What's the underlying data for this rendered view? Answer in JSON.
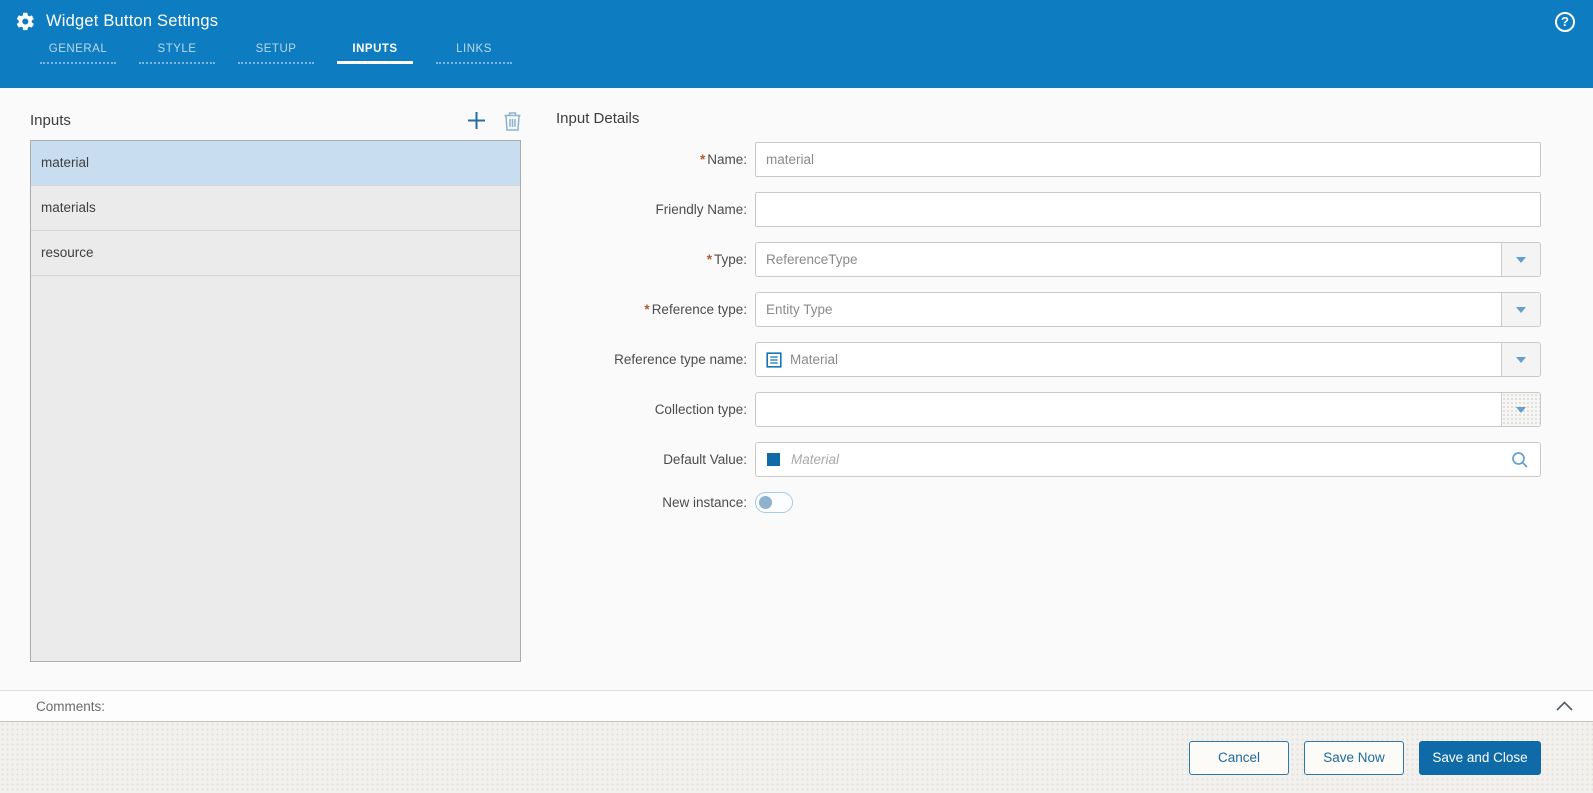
{
  "colors": {
    "header_blue": "#0d7cc1",
    "accent_blue": "#0e6ba8",
    "selected_item_bg": "#c8def0",
    "required_marker_color": "#b35a28"
  },
  "header": {
    "title": "Widget Button Settings",
    "tabs": [
      {
        "label": "GENERAL",
        "active": false
      },
      {
        "label": "STYLE",
        "active": false
      },
      {
        "label": "SETUP",
        "active": false
      },
      {
        "label": "INPUTS",
        "active": true
      },
      {
        "label": "LINKS",
        "active": false
      }
    ]
  },
  "inputs_panel": {
    "title": "Inputs",
    "items": [
      {
        "label": "material",
        "selected": true
      },
      {
        "label": "materials",
        "selected": false
      },
      {
        "label": "resource",
        "selected": false
      }
    ]
  },
  "details": {
    "title": "Input Details",
    "required_marker": "*",
    "fields": {
      "name": {
        "label": "Name:",
        "required": true,
        "value": "material"
      },
      "friendly_name": {
        "label": "Friendly Name:",
        "required": false,
        "value": ""
      },
      "type": {
        "label": "Type:",
        "required": true,
        "value": "ReferenceType"
      },
      "reference_type": {
        "label": "Reference type:",
        "required": true,
        "value": "Entity Type"
      },
      "reference_type_name": {
        "label": "Reference type name:",
        "required": false,
        "value": "Material"
      },
      "collection_type": {
        "label": "Collection type:",
        "required": false,
        "value": ""
      },
      "default_value": {
        "label": "Default Value:",
        "required": false,
        "placeholder": "Material",
        "value": ""
      },
      "new_instance": {
        "label": "New instance:",
        "required": false,
        "value": false
      }
    }
  },
  "comments": {
    "label": "Comments:"
  },
  "footer": {
    "buttons": {
      "cancel": "Cancel",
      "save_now": "Save Now",
      "save_and_close": "Save and Close"
    }
  }
}
